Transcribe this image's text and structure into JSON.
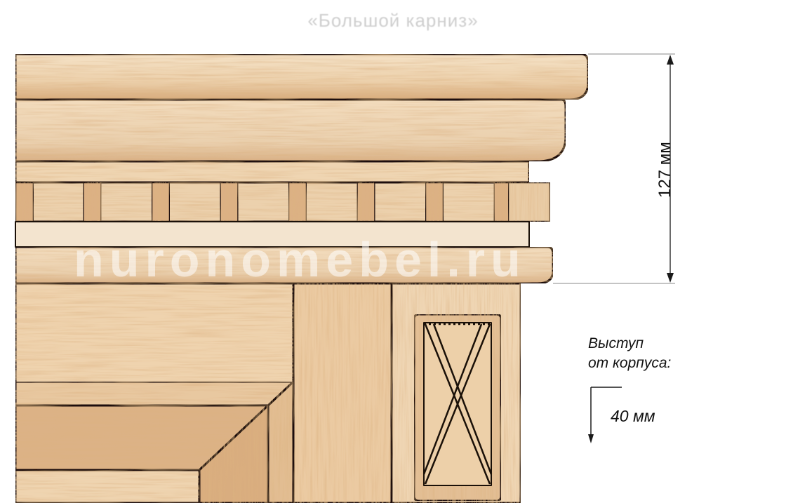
{
  "caption": {
    "title": "«Большой карниз»",
    "height_dimension": "127 мм",
    "projection_label_line1": "Выступ",
    "projection_label_line2": "от корпуса:",
    "projection_value": "40 мм"
  },
  "watermark": "nuronomebel.ru",
  "colors": {
    "wood_light": "#f1d9b8",
    "wood_mid": "#e6c29a",
    "wood_dark": "#c98d5a",
    "outline": "#1a1008",
    "dimension_line": "#1a1a1a"
  }
}
